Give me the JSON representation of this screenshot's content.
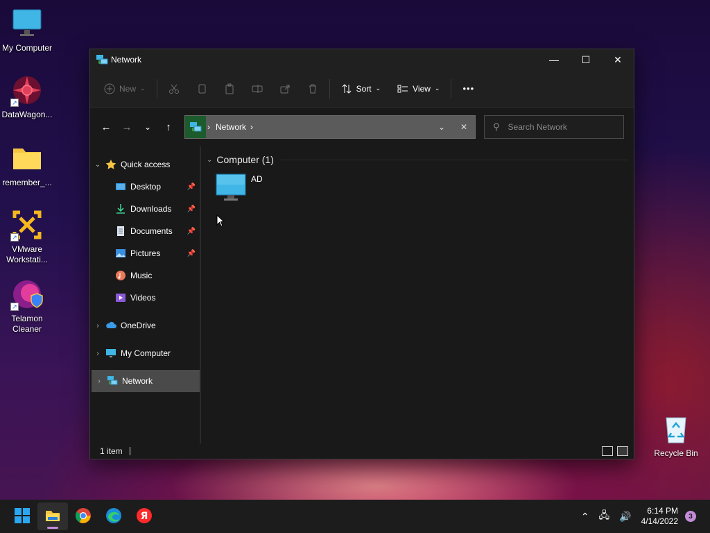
{
  "desktop": {
    "icons": [
      {
        "label": "My Computer"
      },
      {
        "label": "DataWagon..."
      },
      {
        "label": "remember_..."
      },
      {
        "label": "VMware Workstati..."
      },
      {
        "label": "Telamon Cleaner"
      },
      {
        "label": "Recycle Bin"
      }
    ]
  },
  "window": {
    "title": "Network",
    "icon": "network-icon",
    "controls": {
      "minimize": "—",
      "maximize": "☐",
      "close": "✕"
    }
  },
  "commandbar": {
    "new_label": "New",
    "sort_label": "Sort",
    "view_label": "View",
    "more_label": "•••"
  },
  "navigation": {
    "breadcrumb": [
      "Network"
    ],
    "search_placeholder": "Search Network"
  },
  "sidebar": {
    "quick_access": "Quick access",
    "quick_items": [
      {
        "label": "Desktop",
        "icon": "desktop-icon",
        "pinned": true
      },
      {
        "label": "Downloads",
        "icon": "downloads-icon",
        "pinned": true
      },
      {
        "label": "Documents",
        "icon": "documents-icon",
        "pinned": true
      },
      {
        "label": "Pictures",
        "icon": "pictures-icon",
        "pinned": true
      },
      {
        "label": "Music",
        "icon": "music-icon",
        "pinned": false
      },
      {
        "label": "Videos",
        "icon": "videos-icon",
        "pinned": false
      }
    ],
    "onedrive": "OneDrive",
    "mycomputer": "My Computer",
    "network": "Network",
    "selected": "Network"
  },
  "content": {
    "group_title": "Computer (1)",
    "items": [
      {
        "name": "AD",
        "icon": "computer-icon"
      }
    ]
  },
  "status": {
    "count": "1 item"
  },
  "taskbar": {
    "apps": [
      "start-icon",
      "file-explorer-icon",
      "chrome-icon",
      "edge-icon",
      "yandex-icon"
    ],
    "time": "6:14 PM",
    "date": "4/14/2022",
    "notifications": "3"
  },
  "colors": {
    "accent": "#c48bd8",
    "selected_bg": "#4a4a4a",
    "window_bg": "#191919"
  }
}
